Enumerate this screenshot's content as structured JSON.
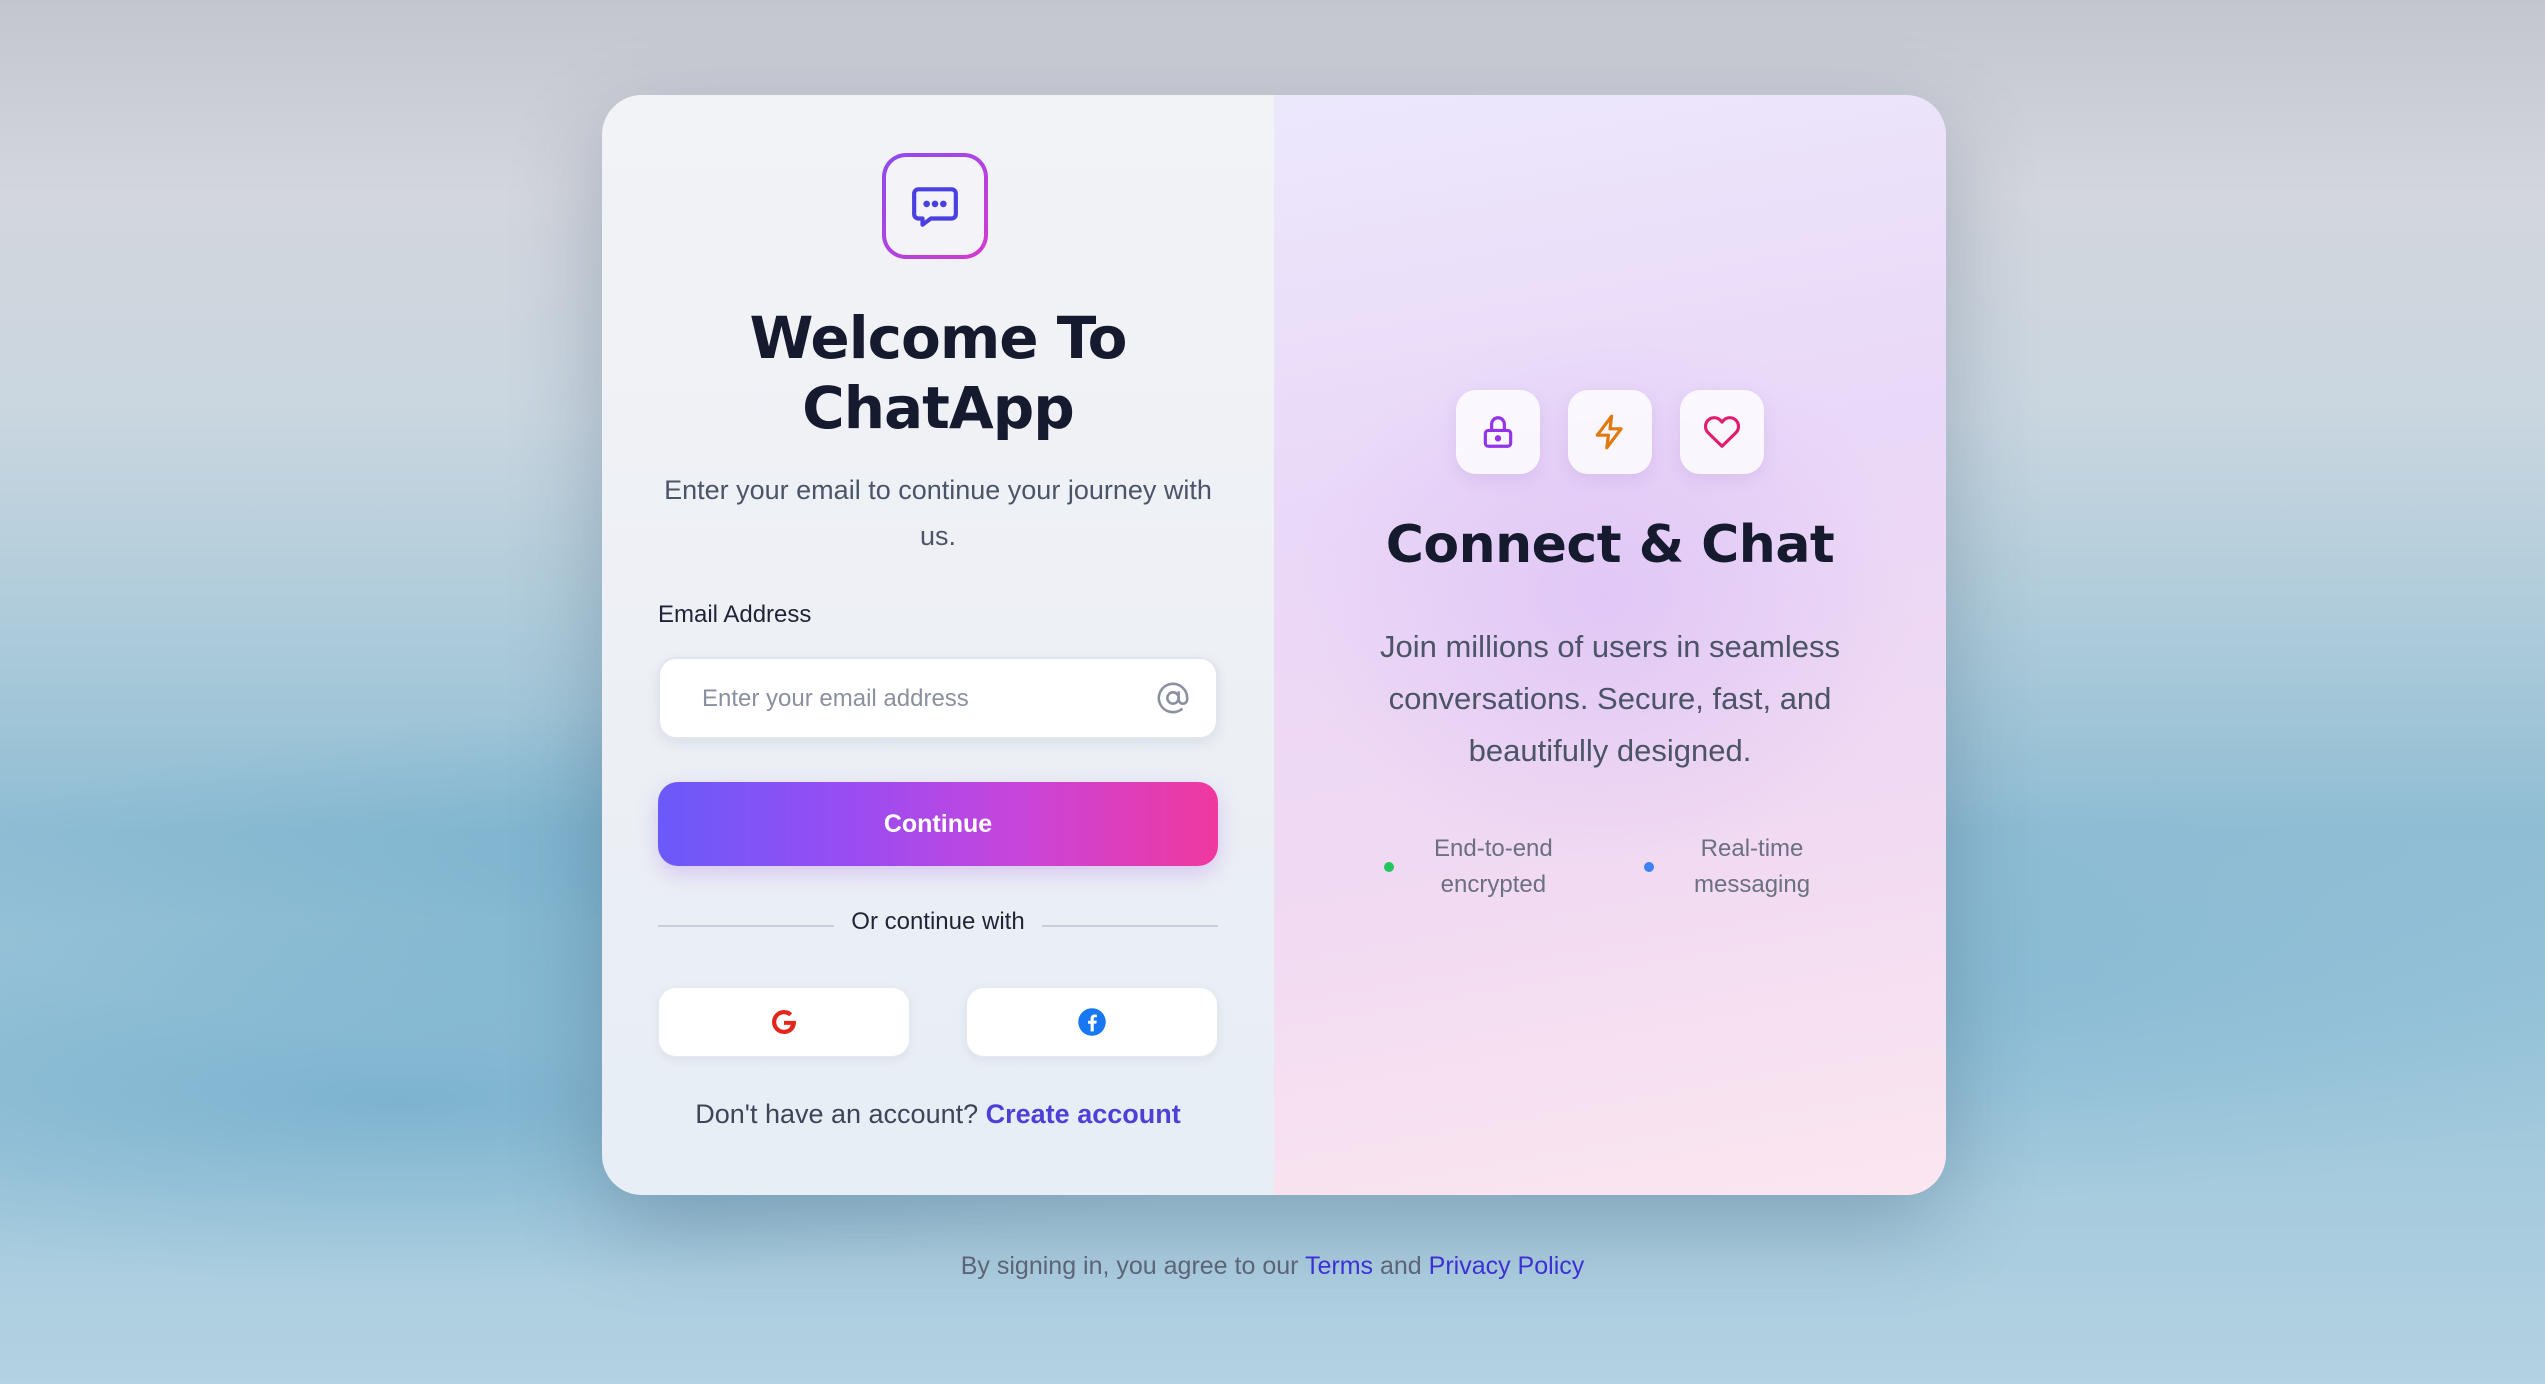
{
  "app": {
    "title_line1": "Welcome To",
    "title_line2": "ChatApp",
    "subtitle": "Enter your email to continue your journey with us."
  },
  "form": {
    "email_label": "Email Address",
    "email_placeholder": "Enter your email address",
    "email_value": "",
    "continue_label": "Continue",
    "divider_text": "Or continue with",
    "social": [
      {
        "icon": "google-icon",
        "color": "#e3261b"
      },
      {
        "icon": "facebook-icon",
        "color": "#1877f2"
      }
    ],
    "signup_prompt": "Don't have an account?",
    "signup_link": "Create account"
  },
  "promo": {
    "icons": [
      {
        "icon": "lock-icon",
        "color": "#9333ea"
      },
      {
        "icon": "lightning-icon",
        "color": "#e07a10"
      },
      {
        "icon": "heart-icon",
        "color": "#e11d72"
      }
    ],
    "title": "Connect & Chat",
    "description": "Join millions of users in seamless conversations. Secure, fast, and beautifully designed.",
    "features": [
      {
        "line1": "End-to-end",
        "line2": "encrypted",
        "dot_color": "#22c55e"
      },
      {
        "line1": "Real-time",
        "line2": "messaging",
        "dot_color": "#3b82f6"
      }
    ]
  },
  "footer": {
    "prefix": "By signing in, you agree to our",
    "terms": "Terms",
    "and": "and",
    "privacy": "Privacy Policy"
  },
  "colors": {
    "accent": "#4f3fd8",
    "button_gradient_start": "#6a5af9",
    "button_gradient_end": "#f0389e"
  }
}
